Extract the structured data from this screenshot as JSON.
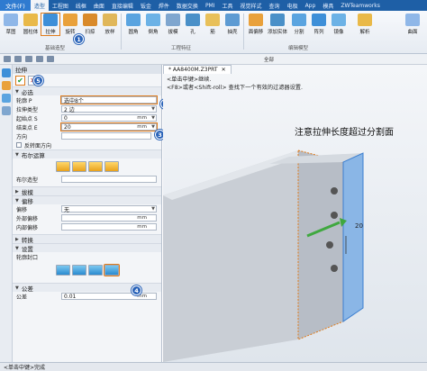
{
  "menubar": {
    "file_label": "文件(F)",
    "tabs": [
      "造型",
      "工程图",
      "线框",
      "曲面",
      "直接编辑",
      "钣金",
      "焊件",
      "数据交换",
      "PMI",
      "工具",
      "视觉样式",
      "查询",
      "电极",
      "App",
      "模具",
      "ZWTeamworks"
    ],
    "active_tab": 0
  },
  "ribbon": {
    "buttons": [
      "草图",
      "圆柱体",
      "拉伸",
      "旋转",
      "扫掠",
      "放样",
      "圆角",
      "倒角",
      "拔模",
      "孔",
      "筋",
      "抽壳",
      "面偏移",
      "添加实体",
      "分割",
      "阵列",
      "镜像",
      "解析",
      "曲面"
    ],
    "groups": [
      "基础造型",
      "工程特征",
      "编辑模型"
    ]
  },
  "quickbar": {
    "filter": "全部",
    "scope": "零件"
  },
  "panel": {
    "title": "拉伸",
    "section_required": "必选",
    "profile_label": "轮廓 P",
    "profile_value": "选中8个",
    "extrude_type_label": "拉伸类型",
    "extrude_type_value": "2 边",
    "start_label": "起始点 S",
    "start_value": "0",
    "end_label": "结束点 E",
    "end_value": "20",
    "unit": "mm",
    "direction_label": "方向",
    "reverse_label": "反转面方向",
    "section_boolean": "布尔运算",
    "boolean_shape_label": "布尔造型",
    "section_draft": "拔模",
    "section_offset": "偏移",
    "offset_label": "偏移",
    "offset_value": "无",
    "outer_offset_label": "外部偏移",
    "inner_offset_label": "内部偏移",
    "section_transform": "转换",
    "section_settings": "设置",
    "profile_cap_label": "轮廓封口",
    "section_tolerance": "公差",
    "tolerance_label": "公差",
    "tolerance_value": "0.01"
  },
  "badges": [
    "1",
    "2",
    "3",
    "4",
    "5"
  ],
  "viewport": {
    "tab_label": "* AA8400M.Z3PRT",
    "hint_line1": "<单击中键>继续.",
    "hint_line2": "<F8>或者<Shift-roll> 查找下一个有效的过滤器设置.",
    "annotation": "注意拉伸长度超过分割面",
    "dimension": "20"
  },
  "status": {
    "text": "<单击中键>完成"
  },
  "colors": {
    "highlight": "#e07b1a",
    "badge": "#2a63b8",
    "accent": "#1e5fa6"
  }
}
